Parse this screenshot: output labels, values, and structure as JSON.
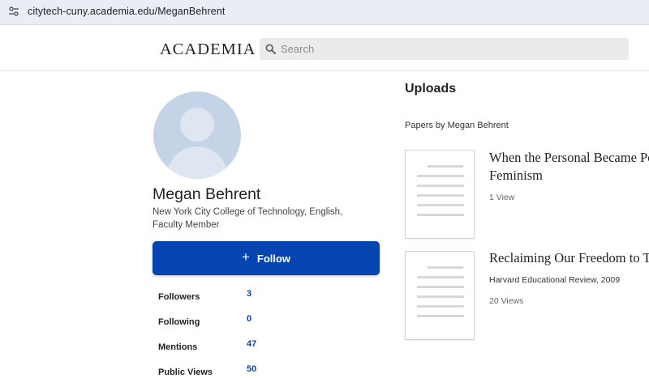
{
  "browser": {
    "url": "citytech-cuny.academia.edu/MeganBehrent",
    "site_icon": "site-info-icon"
  },
  "header": {
    "logo": "ACADEMIA",
    "search_placeholder": "Search",
    "search_icon": "search-icon"
  },
  "profile": {
    "name": "Megan Behrent",
    "affiliation": "New York City College of Technology, English, Faculty Member",
    "follow_label": "Follow",
    "follow_icon": "plus-icon",
    "stats": [
      {
        "label": "Followers",
        "value": "3"
      },
      {
        "label": "Following",
        "value": "0"
      },
      {
        "label": "Mentions",
        "value": "47"
      },
      {
        "label": "Public Views",
        "value": "50"
      }
    ]
  },
  "uploads": {
    "title": "Uploads",
    "section_label": "Papers by Megan Behrent",
    "papers": [
      {
        "title_line1": "When the Personal Became Po",
        "title_line2": "Feminism",
        "meta": "",
        "views": "1 View"
      },
      {
        "title_line1": "Reclaiming Our Freedom to T",
        "title_line2": "",
        "meta": "Harvard Educational Review, 2009",
        "views": "20 Views"
      }
    ]
  },
  "colors": {
    "accent": "#0645b1",
    "address_bar": "#e9eef6",
    "avatar_bg": "#c5d3e6"
  }
}
